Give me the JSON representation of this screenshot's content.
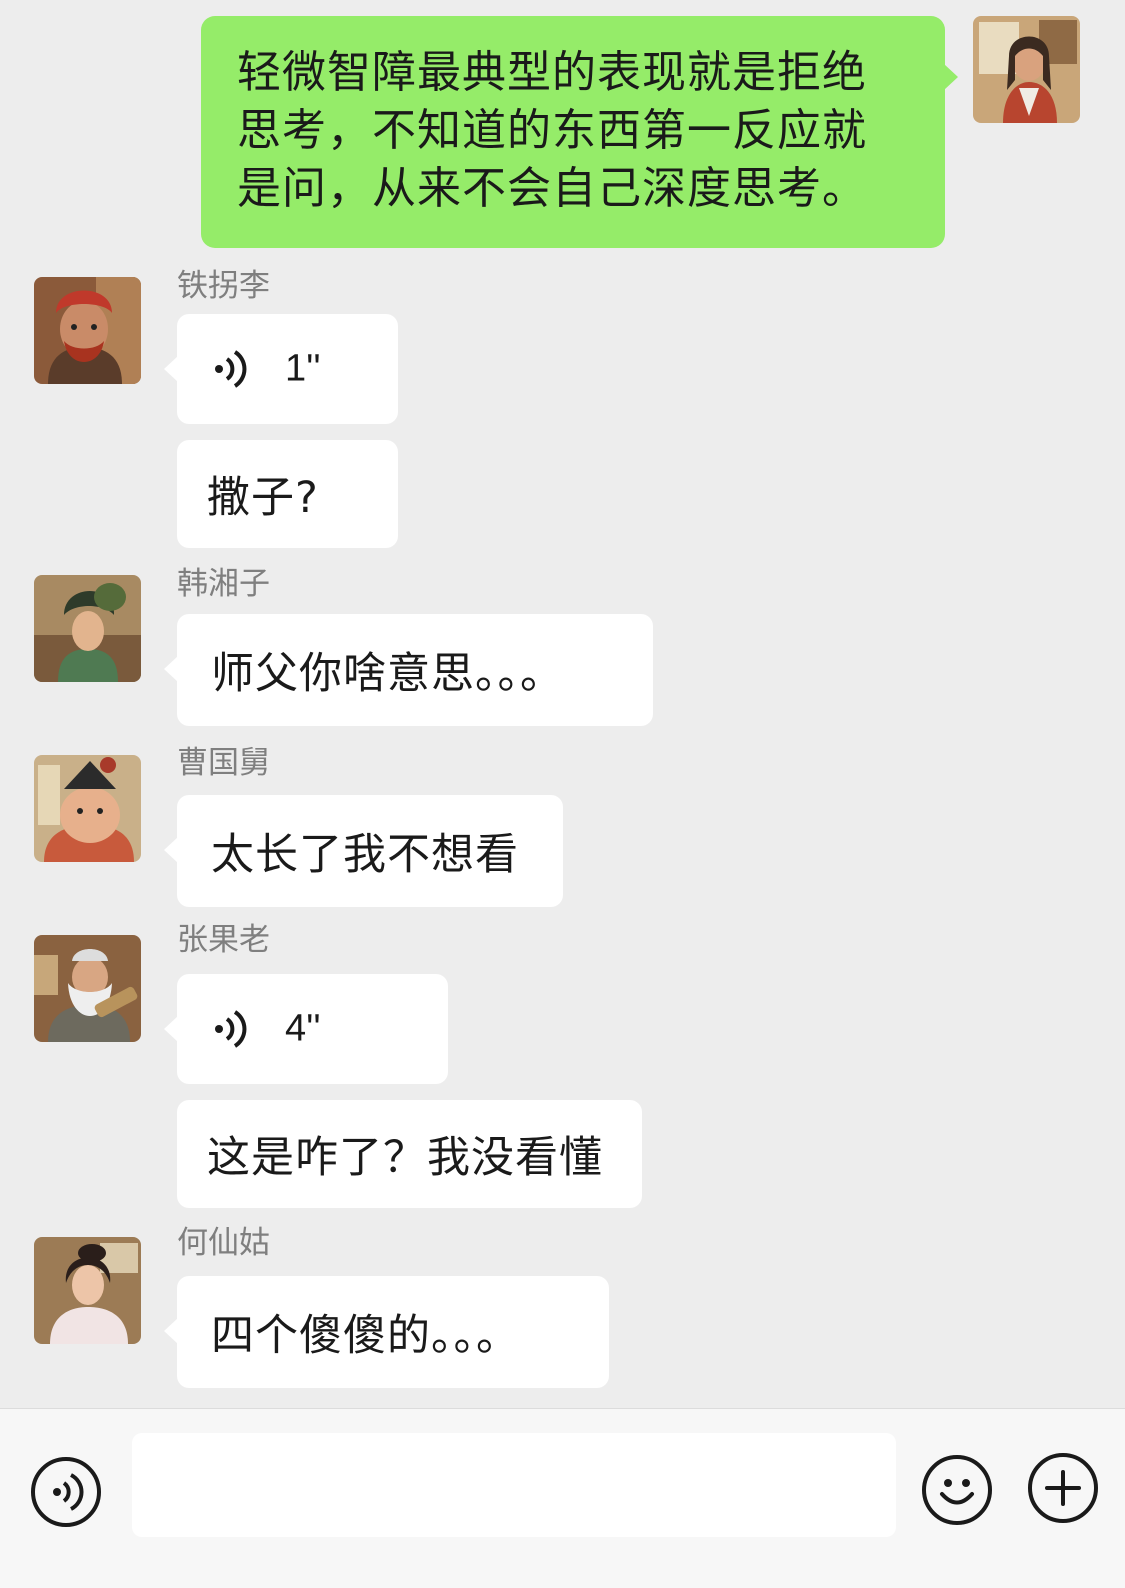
{
  "me": {
    "message": "轻微智障最典型的表现就是拒绝思考，不知道的东西第一反应就是问，从来不会自己深度思考。",
    "message_lines": [
      "轻微智障最典型的表现就是拒绝",
      "思考，不知道的东西第一反应就",
      "是问，从来不会自己深度思考。"
    ]
  },
  "messages": [
    {
      "sender": "铁拐李",
      "voice": "1''",
      "text": "撒子?"
    },
    {
      "sender": "韩湘子",
      "text": "师父你啥意思。。。"
    },
    {
      "sender": "曹国舅",
      "text": "太长了我不想看"
    },
    {
      "sender": "张果老",
      "voice": "4''",
      "text": "这是咋了？我没看懂"
    },
    {
      "sender": "何仙姑",
      "text": "四个傻傻的。。。"
    }
  ],
  "input": {
    "placeholder": ""
  },
  "icons": {
    "voice_button": "voice-icon",
    "emoji_button": "smiley-icon",
    "more_button": "plus-icon"
  },
  "colors": {
    "outgoing_bubble": "#95ec69",
    "incoming_bubble": "#ffffff",
    "background": "#ededed"
  }
}
